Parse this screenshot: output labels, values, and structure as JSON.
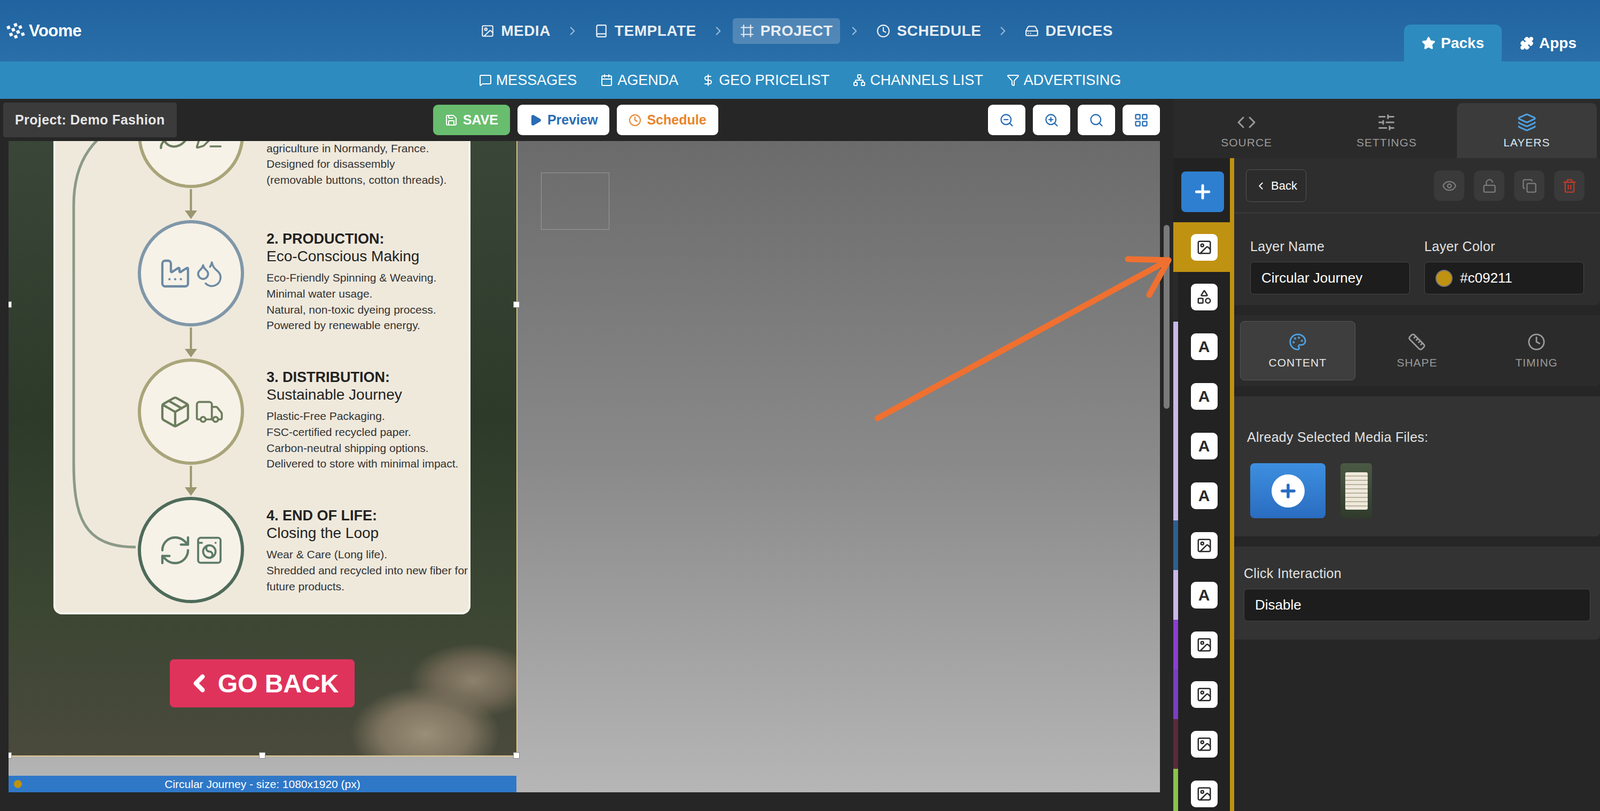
{
  "header": {
    "logo": "Voome",
    "nav": [
      {
        "label": "MEDIA",
        "selected": false
      },
      {
        "label": "TEMPLATE",
        "selected": false
      },
      {
        "label": "PROJECT",
        "selected": true
      },
      {
        "label": "SCHEDULE",
        "selected": false
      },
      {
        "label": "DEVICES",
        "selected": false
      }
    ],
    "tabs": [
      {
        "label": "Packs",
        "selected": true
      },
      {
        "label": "Apps",
        "selected": false
      }
    ]
  },
  "subnav": [
    {
      "label": "MESSAGES"
    },
    {
      "label": "AGENDA"
    },
    {
      "label": "GEO PRICELIST"
    },
    {
      "label": "CHANNELS LIST"
    },
    {
      "label": "ADVERTISING"
    }
  ],
  "toolbar": {
    "project": "Project: Demo Fashion",
    "save": "SAVE",
    "preview": "Preview",
    "schedule": "Schedule"
  },
  "canvas": {
    "layer": {
      "steps": [
        {
          "kind": "partial",
          "lines": [
            "agriculture in Normandy, France.",
            "Designed for disassembly",
            "(removable buttons, cotton threads)."
          ],
          "color": "#a9a57a"
        },
        {
          "kind": "full",
          "title": "2. PRODUCTION:",
          "subtitle": "Eco-Conscious Making",
          "lines": [
            "Eco-Friendly Spinning & Weaving.",
            "Minimal water usage.",
            "Natural, non-toxic dyeing process.",
            "Powered by renewable energy."
          ],
          "color": "#8097a8"
        },
        {
          "kind": "full",
          "title": "3. DISTRIBUTION:",
          "subtitle": "Sustainable Journey",
          "lines": [
            "Plastic-Free Packaging.",
            "FSC-certified recycled paper.",
            "Carbon-neutral shipping options.",
            "Delivered to store with minimal impact."
          ],
          "color": "#a9a57a"
        },
        {
          "kind": "full",
          "title": "4. END OF LIFE:",
          "subtitle": "Closing the Loop",
          "lines": [
            "Wear & Care (Long life).",
            "Shredded and recycled into new fiber for future products."
          ],
          "color": "#4e6b5a"
        }
      ],
      "button": "GO BACK"
    },
    "selection_label": "Circular Journey - size: 1080x1920 (px)"
  },
  "panel": {
    "tabs": [
      {
        "label": "SOURCE",
        "selected": false
      },
      {
        "label": "SETTINGS",
        "selected": false
      },
      {
        "label": "LAYERS",
        "selected": true
      }
    ],
    "layers": [
      {
        "kind": "image",
        "selected": true,
        "color": "#c09211"
      },
      {
        "kind": "shape",
        "selected": false,
        "color": "#2a2a2a"
      },
      {
        "kind": "text",
        "glyph": "A",
        "selected": false,
        "color": "#c9b8e8"
      },
      {
        "kind": "text",
        "glyph": "A",
        "selected": false,
        "color": "#c9b8e8"
      },
      {
        "kind": "text",
        "glyph": "A",
        "selected": false,
        "color": "#c9b8e8"
      },
      {
        "kind": "text",
        "glyph": "A",
        "selected": false,
        "color": "#c9b8e8"
      },
      {
        "kind": "image",
        "selected": false,
        "color": "#2f5f8f"
      },
      {
        "kind": "text",
        "glyph": "A",
        "selected": false,
        "color": "#c9b8e8"
      },
      {
        "kind": "image",
        "selected": false,
        "color": "#8a3fd0"
      },
      {
        "kind": "image",
        "selected": false,
        "color": "#7a3fc0"
      },
      {
        "kind": "image",
        "selected": false,
        "color": "#5a2a3a"
      },
      {
        "kind": "image",
        "selected": false,
        "color": "#8bc34a"
      }
    ],
    "back": "Back",
    "layer_name": {
      "label": "Layer Name",
      "value": "Circular Journey"
    },
    "layer_color": {
      "label": "Layer Color",
      "value": "#c09211"
    },
    "content_tabs": [
      {
        "label": "CONTENT",
        "selected": true
      },
      {
        "label": "SHAPE",
        "selected": false
      },
      {
        "label": "TIMING",
        "selected": false
      }
    ],
    "media": {
      "label": "Already Selected Media Files:"
    },
    "click": {
      "label": "Click Interaction",
      "value": "Disable"
    }
  }
}
